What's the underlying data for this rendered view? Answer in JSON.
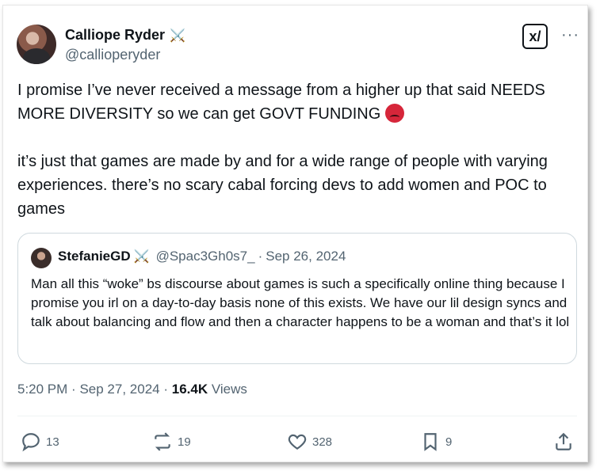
{
  "author": {
    "name": "Calliope Ryder",
    "name_badge": "⚔️",
    "handle": "@callioperyder"
  },
  "post": {
    "paragraph1_text": "I promise I’ve never received a message from a higher up that said NEEDS MORE DIVERSITY so we can get GOVT FUNDING",
    "paragraph1_emoji": "angry-face",
    "paragraph2": "it’s just that games are made by and for a wide range of people with varying experiences. there’s no scary cabal forcing devs to add women and POC to games"
  },
  "quote": {
    "name": "StefanieGD",
    "name_badge": "⚔️",
    "handle": "@Spac3Gh0s7_",
    "date": "Sep 26, 2024",
    "separator": "·",
    "text": "Man all this “woke” bs discourse about games is such a specifically online thing because I promise you irl on a day-to-day basis none of this exists. We have our lil design syncs and talk about balancing and flow and then a character happens to be a woman and that’s it lol"
  },
  "meta": {
    "time": "5:20 PM",
    "date": "Sep 27, 2024",
    "separator": "·",
    "views_count": "16.4K",
    "views_label": "Views"
  },
  "actions": {
    "replies": "13",
    "reposts": "19",
    "likes": "328",
    "bookmarks": "9"
  },
  "header": {
    "grok_label": "x/",
    "more_label": "···"
  },
  "colors": {
    "text": "#0f1419",
    "secondary": "#536471",
    "border": "#cfd9de"
  }
}
